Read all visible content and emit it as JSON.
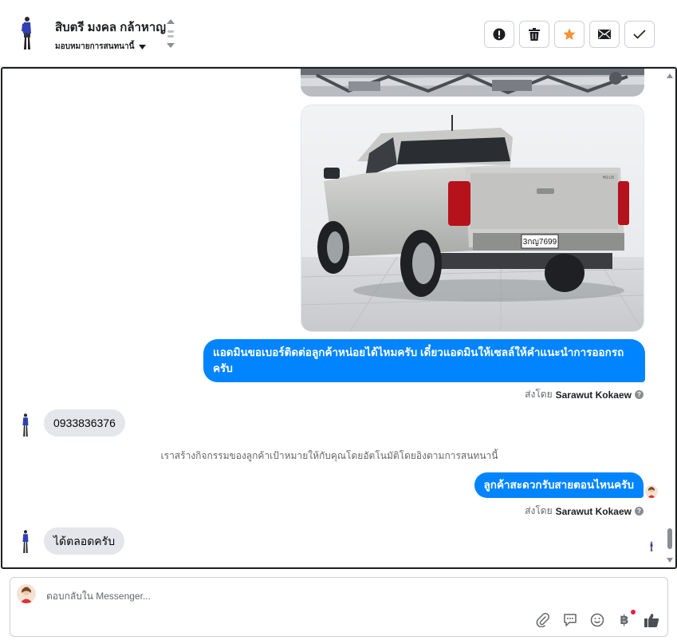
{
  "header": {
    "contact_name": "สิบตรี มงคล กล้าหาญ",
    "assign_label": "มอบหมายการสนทนานี้",
    "actions": [
      {
        "name": "spam-icon",
        "color": "#1c1e21"
      },
      {
        "name": "trash-icon",
        "color": "#1c1e21"
      },
      {
        "name": "star-icon",
        "color": "#f7923a"
      },
      {
        "name": "mail-icon",
        "color": "#1c1e21"
      },
      {
        "name": "check-icon",
        "color": "#1c1e21"
      }
    ]
  },
  "chat": {
    "messages": [
      {
        "id": "m1",
        "from": "page",
        "text": "แอดมินขอเบอร์ติดต่อลูกค้าหน่อยได้ไหมครับ เดี๋ยวแอดมินให้เซลล์ให้คำแนะนำการออกรถครับ"
      },
      {
        "id": "m2",
        "from": "customer",
        "text": "0933836376"
      },
      {
        "id": "m3",
        "from": "page",
        "text": "ลูกค้าสะดวกรับสายตอนไหนครับ"
      },
      {
        "id": "m4",
        "from": "customer",
        "text": "ได้ตลอดครับ"
      }
    ],
    "sent_by_prefix": "ส่งโดย",
    "sent_by_name": "Sarawut Kokaew",
    "info_glyph": "?",
    "system_note": "เราสร้างกิจกรรมของลูกค้าเป้าหมายให้กับคุณโดยอัตโนมัติโดยอิงตามการสนทนานี้",
    "car_plate": "3กญ7699",
    "car_badge": "HILUX"
  },
  "composer": {
    "placeholder": "ตอบกลับใน Messenger...",
    "tools": [
      "attachment-icon",
      "saved-reply-icon",
      "emoji-icon",
      "payment-icon",
      "like-icon"
    ],
    "payment_glyph": "฿"
  },
  "colors": {
    "accent": "#0084ff",
    "incoming_bubble": "#e4e6eb",
    "star": "#f7923a",
    "notification": "#e41e3f"
  }
}
